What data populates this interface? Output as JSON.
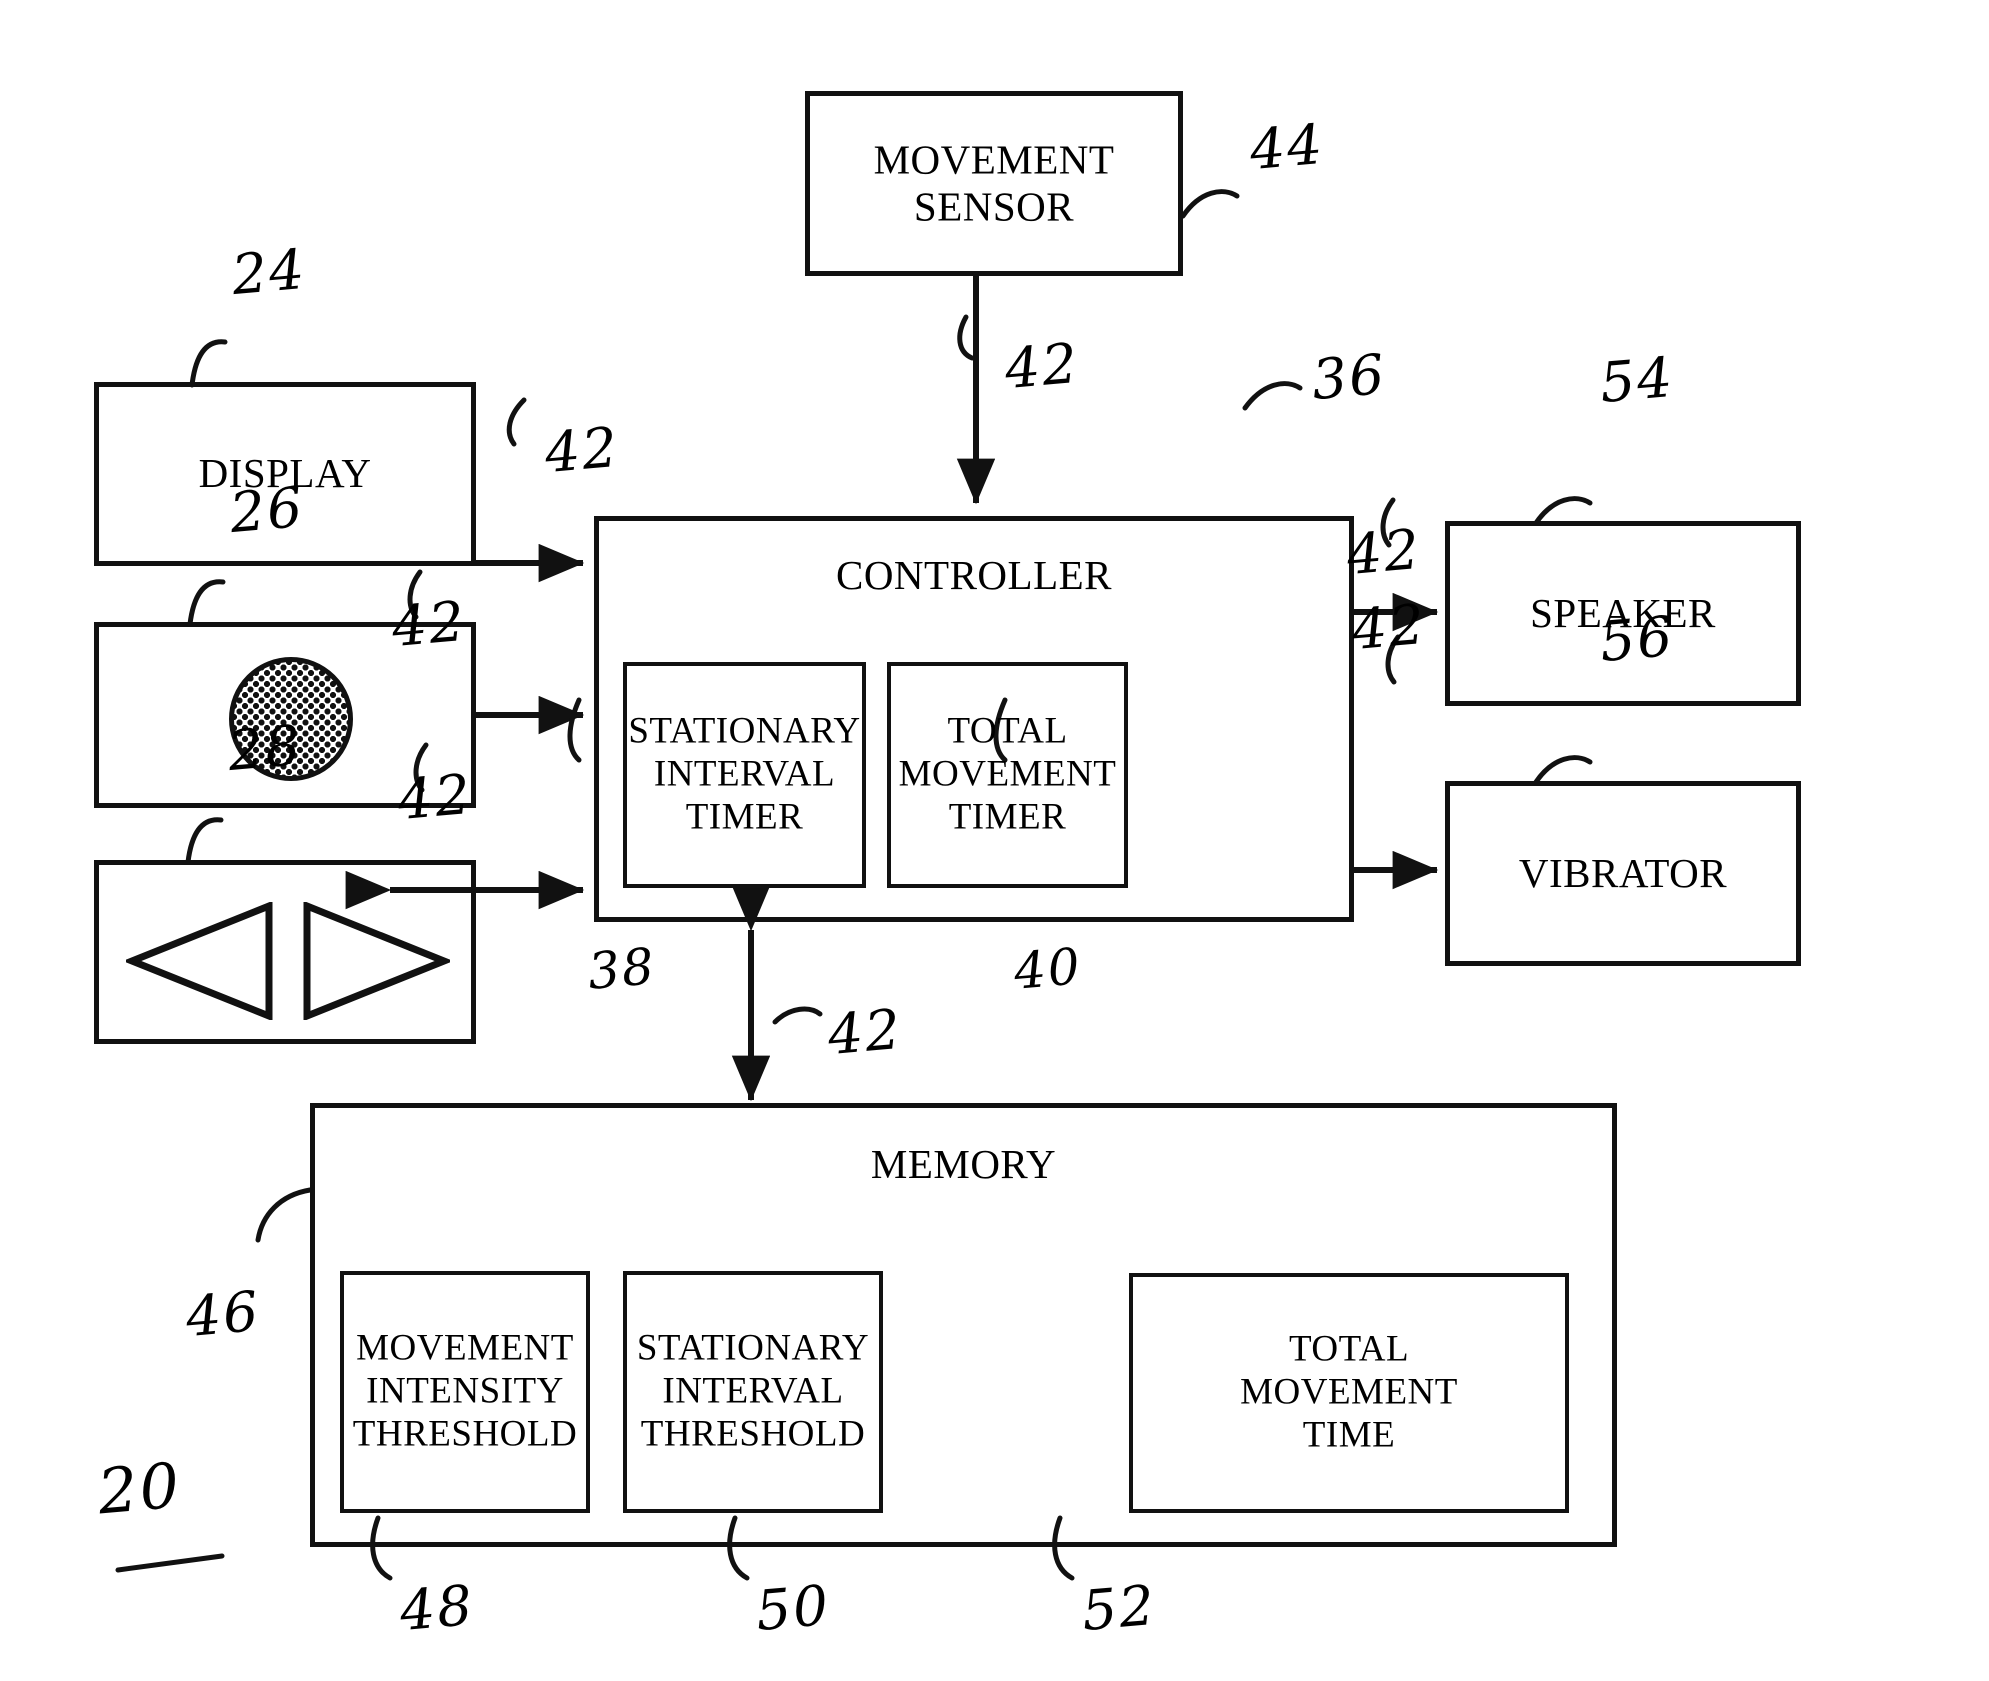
{
  "figure": {
    "kind": "patent-block-diagram",
    "overall_ref": "20",
    "ink_color": "#111111",
    "background": "#ffffff"
  },
  "blocks": {
    "movement_sensor": {
      "label": "MOVEMENT\nSENSOR",
      "ref": "44"
    },
    "display": {
      "label": "DISPLAY",
      "ref": "24"
    },
    "indicator": {
      "label": "",
      "ref": "26",
      "icon": "stippled-circle"
    },
    "buttons": {
      "label": "",
      "ref": "28",
      "icon_left": "left-triangle",
      "icon_right": "right-triangle"
    },
    "controller": {
      "label": "CONTROLLER",
      "ref": "36"
    },
    "stationary_interval_timer": {
      "label": "STATIONARY\nINTERVAL\nTIMER",
      "ref": "38"
    },
    "total_movement_timer": {
      "label": "TOTAL\nMOVEMENT\nTIMER",
      "ref": "40"
    },
    "speaker": {
      "label": "SPEAKER",
      "ref": "54"
    },
    "vibrator": {
      "label": "VIBRATOR",
      "ref": "56"
    },
    "memory": {
      "label": "MEMORY",
      "ref": "46"
    },
    "movement_intensity_threshold": {
      "label": "MOVEMENT\nINTENSITY\nTHRESHOLD",
      "ref": "48"
    },
    "stationary_interval_threshold": {
      "label": "STATIONARY\nINTERVAL\nTHRESHOLD",
      "ref": "50"
    },
    "total_movement_time": {
      "label": "TOTAL\nMOVEMENT\nTIME",
      "ref": "52"
    }
  },
  "connections": [
    {
      "id": "sensor-to-controller",
      "ref": "42",
      "from": "movement_sensor",
      "to": "controller",
      "arrow": "single"
    },
    {
      "id": "display-to-controller",
      "ref": "42",
      "from": "display",
      "to": "controller",
      "arrow": "single"
    },
    {
      "id": "indicator-to-controller",
      "ref": "42",
      "from": "indicator",
      "to": "controller",
      "arrow": "single"
    },
    {
      "id": "buttons-controller",
      "ref": "42",
      "from": "buttons",
      "to": "controller",
      "arrow": "double"
    },
    {
      "id": "controller-to-speaker",
      "ref": "42",
      "from": "controller",
      "to": "speaker",
      "arrow": "single"
    },
    {
      "id": "controller-to-vibrator",
      "ref": "42",
      "from": "controller",
      "to": "vibrator",
      "arrow": "single"
    },
    {
      "id": "controller-memory",
      "ref": "42",
      "from": "controller",
      "to": "memory",
      "arrow": "double"
    }
  ]
}
